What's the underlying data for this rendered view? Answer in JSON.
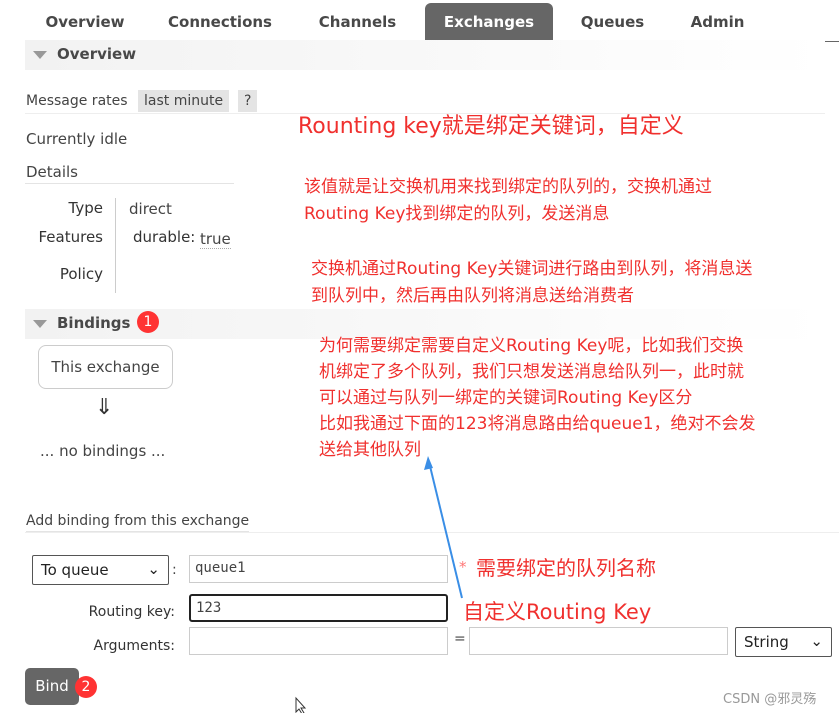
{
  "nav": {
    "tabs": [
      {
        "label": "Overview"
      },
      {
        "label": "Connections"
      },
      {
        "label": "Channels"
      },
      {
        "label": "Exchanges",
        "active": true
      },
      {
        "label": "Queues"
      },
      {
        "label": "Admin"
      }
    ]
  },
  "overview": {
    "title": "Overview",
    "message_rates_label": "Message rates",
    "rate_period": "last minute",
    "help": "?",
    "status": "Currently idle",
    "details_label": "Details",
    "type_label": "Type",
    "type_value": "direct",
    "features_label": "Features",
    "durable_label": "durable:",
    "durable_value": "true",
    "policy_label": "Policy"
  },
  "bindings": {
    "title": "Bindings",
    "badge": "1",
    "this_exchange": "This exchange",
    "arrow": "⇓",
    "no_bindings": "... no bindings ..."
  },
  "add_binding": {
    "title": "Add binding from this exchange",
    "destination_type": "To queue",
    "colon": ":",
    "destination_value": "queue1",
    "required_mark": "*",
    "routing_key_label": "Routing key:",
    "routing_key_value": "123",
    "arguments_label": "Arguments:",
    "equals": "=",
    "arg_type": "String",
    "bind_label": "Bind",
    "bind_badge": "2"
  },
  "annotations": {
    "a1": "Rounting key就是绑定关键词，自定义",
    "a2": "该值就是让交换机用来找到绑定的队列的，交换机通过",
    "a2b": "Routing Key找到绑定的队列，发送消息",
    "a3": "交换机通过Routing Key关键词进行路由到队列，将消息送",
    "a3b": "到队列中，然后再由队列将消息送给消费者",
    "a4": [
      "为何需要绑定需要自定义Routing Key呢，比如我们交换",
      "机绑定了多个队列，我们只想发送消息给队列一，此时就",
      "可以通过与队列一绑定的关键词Routing Key区分",
      "比如我通过下面的123将消息路由给queue1，绝对不会发",
      "送给其他队列"
    ],
    "queue_name_note": "需要绑定的队列名称",
    "routing_key_note": "自定义Routing Key",
    "arrow_color": "#3a8ee6",
    "text_color": "#f0302e"
  },
  "watermark": "CSDN @邪灵殇"
}
